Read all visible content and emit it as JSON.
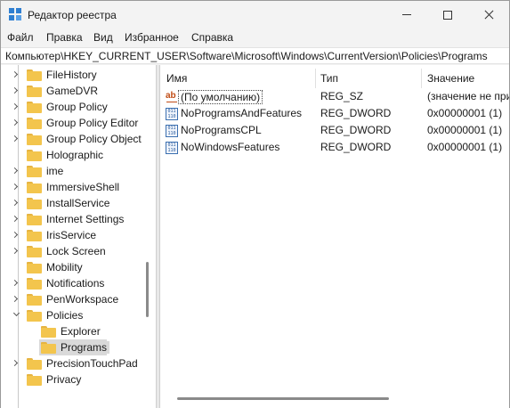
{
  "window": {
    "title": "Редактор реестра"
  },
  "menu": [
    "Файл",
    "Правка",
    "Вид",
    "Избранное",
    "Справка"
  ],
  "address": "Компьютер\\HKEY_CURRENT_USER\\Software\\Microsoft\\Windows\\CurrentVersion\\Policies\\Programs",
  "tree": {
    "items": [
      {
        "label": "FileHistory",
        "expander": "collapsed"
      },
      {
        "label": "GameDVR",
        "expander": "collapsed"
      },
      {
        "label": "Group Policy",
        "expander": "collapsed"
      },
      {
        "label": "Group Policy Editor",
        "expander": "collapsed"
      },
      {
        "label": "Group Policy Object",
        "expander": "collapsed"
      },
      {
        "label": "Holographic",
        "expander": "none"
      },
      {
        "label": "ime",
        "expander": "collapsed"
      },
      {
        "label": "ImmersiveShell",
        "expander": "collapsed"
      },
      {
        "label": "InstallService",
        "expander": "collapsed"
      },
      {
        "label": "Internet Settings",
        "expander": "collapsed"
      },
      {
        "label": "IrisService",
        "expander": "collapsed"
      },
      {
        "label": "Lock Screen",
        "expander": "collapsed"
      },
      {
        "label": "Mobility",
        "expander": "none"
      },
      {
        "label": "Notifications",
        "expander": "collapsed"
      },
      {
        "label": "PenWorkspace",
        "expander": "collapsed"
      },
      {
        "label": "Policies",
        "expander": "expanded"
      },
      {
        "label": "Explorer",
        "expander": "none",
        "child": true
      },
      {
        "label": "Programs",
        "expander": "none",
        "child": true,
        "selected": true
      },
      {
        "label": "PrecisionTouchPad",
        "expander": "collapsed"
      },
      {
        "label": "Privacy",
        "expander": "none"
      }
    ]
  },
  "list": {
    "columns": [
      "Имя",
      "Тип",
      "Значение"
    ],
    "rows": [
      {
        "icon": "string-value-icon",
        "name": "(По умолчанию)",
        "type": "REG_SZ",
        "value": "(значение не присвоено)",
        "focused": true
      },
      {
        "icon": "dword-value-icon",
        "name": "NoProgramsAndFeatures",
        "type": "REG_DWORD",
        "value": "0x00000001 (1)"
      },
      {
        "icon": "dword-value-icon",
        "name": "NoProgramsCPL",
        "type": "REG_DWORD",
        "value": "0x00000001 (1)"
      },
      {
        "icon": "dword-value-icon",
        "name": "NoWindowsFeatures",
        "type": "REG_DWORD",
        "value": "0x00000001 (1)"
      }
    ]
  },
  "colors": {
    "folder": "#f3c54d",
    "selection": "#d9d9d9",
    "app_icon": "#2f7fd1"
  }
}
